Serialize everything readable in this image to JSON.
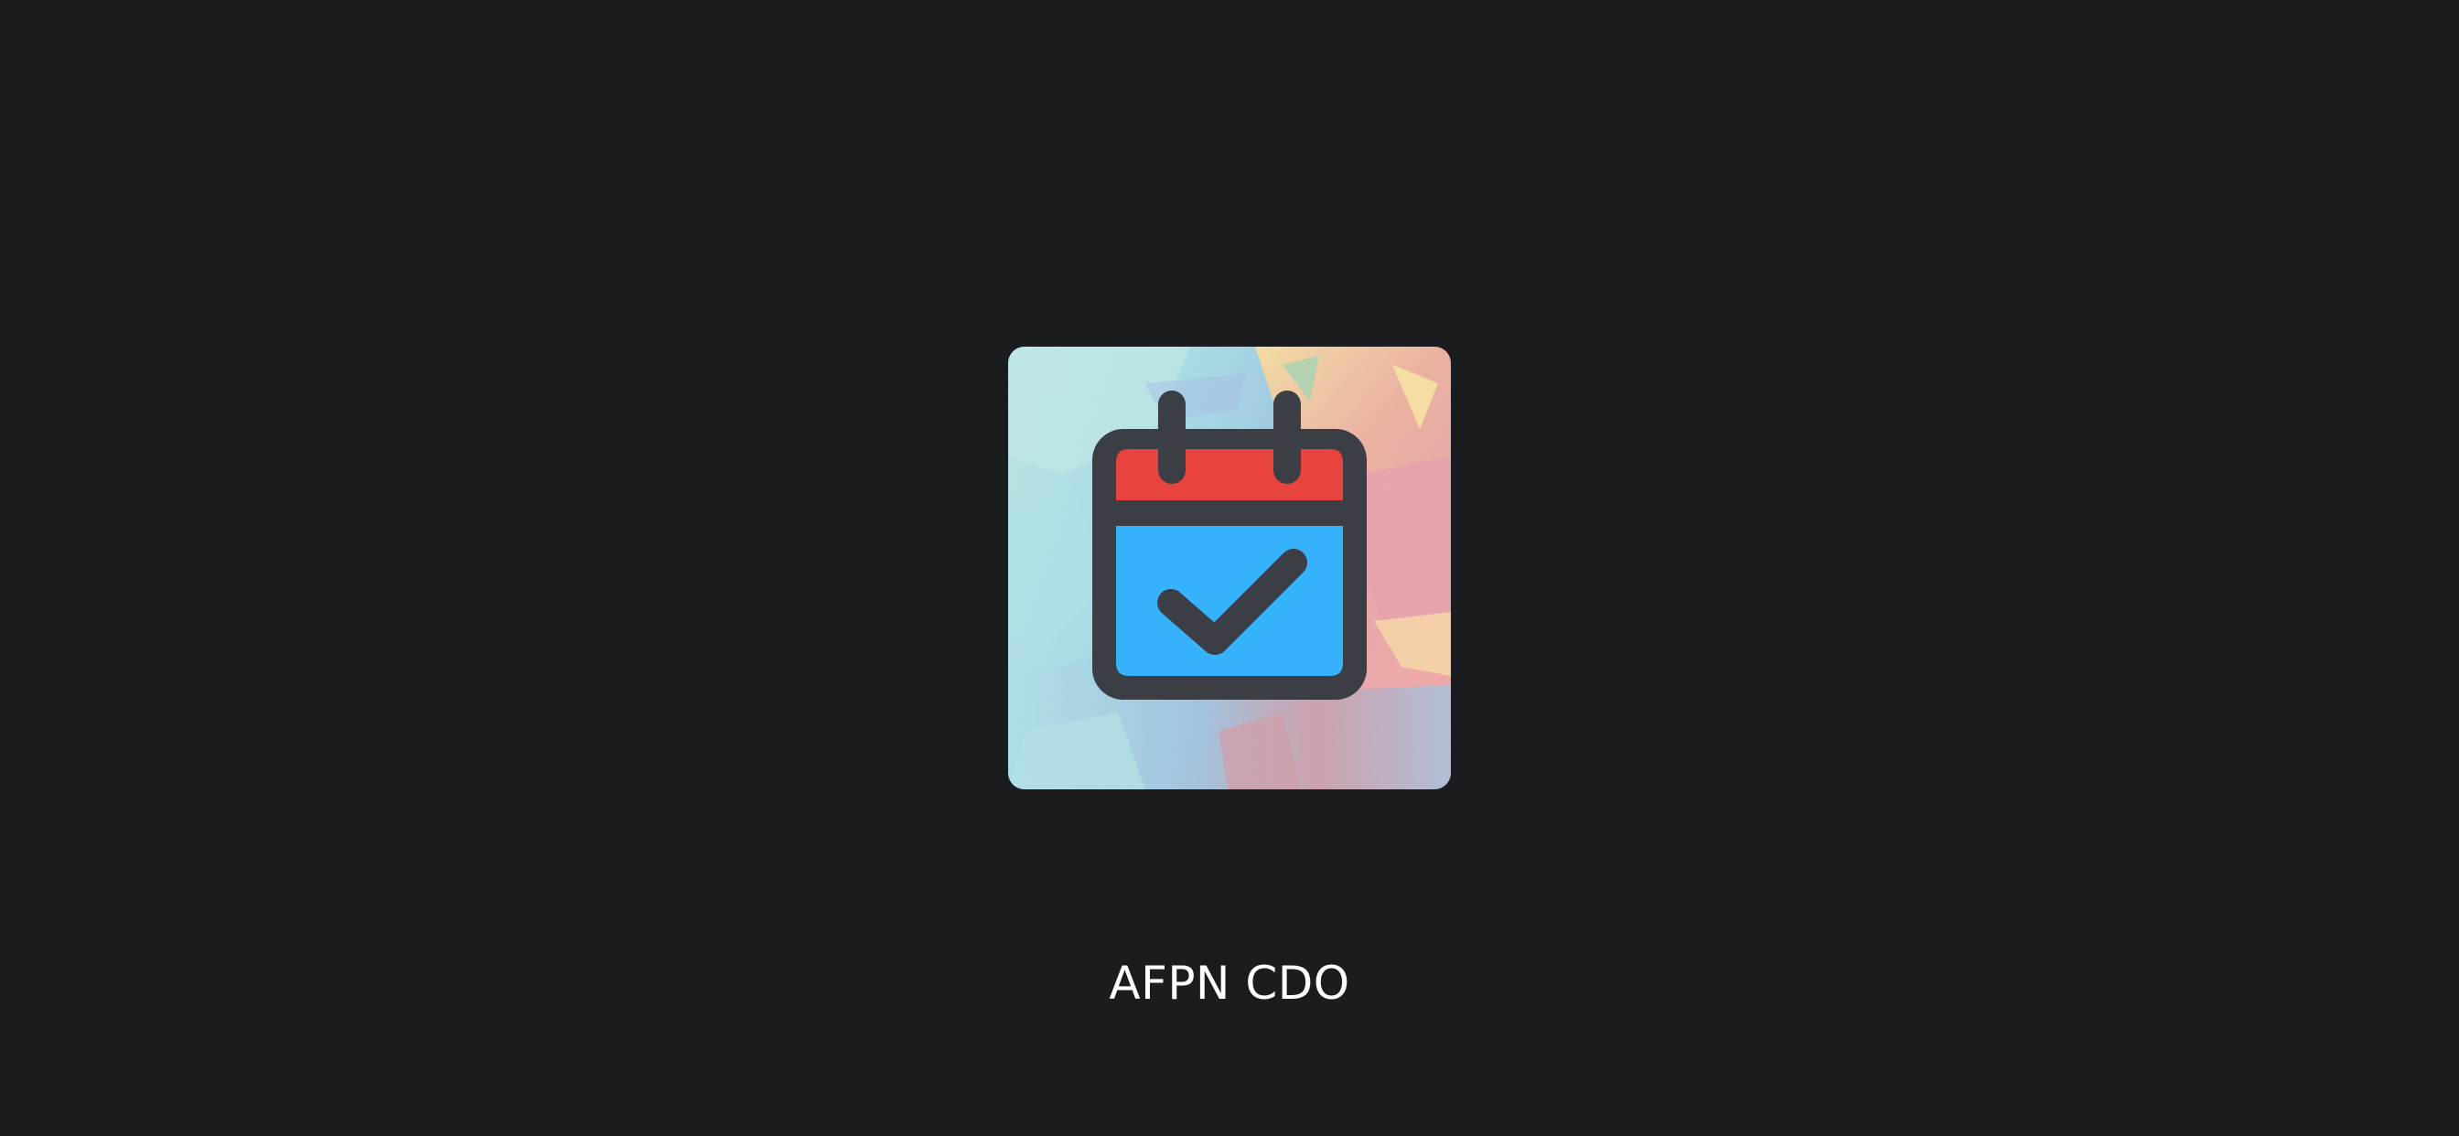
{
  "splash": {
    "app_name": "AFPN CDO",
    "icon": "calendar-check-icon"
  },
  "colors": {
    "background": "#1b1c1f",
    "icon_header_red": "#e8433c",
    "icon_body_blue": "#36b1fb",
    "icon_stroke": "#3b3e44",
    "text": "#ffffff"
  }
}
